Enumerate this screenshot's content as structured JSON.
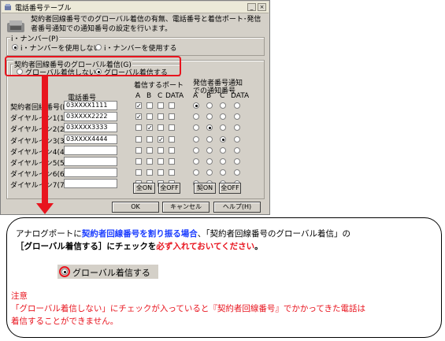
{
  "window": {
    "title": "電話番号テーブル",
    "minimize": "_",
    "close": "×"
  },
  "description": "契約者回線番号でのグローバル着信の有無、電話番号と着信ポート･発信者番号通知での通知番号の設定を行います。",
  "inumber_group": {
    "label": "i・ナンバー(P)",
    "options": [
      {
        "label": "i・ナンバーを使用しない",
        "selected": true
      },
      {
        "label": "i・ナンバーを使用する",
        "selected": false
      }
    ]
  },
  "global_group": {
    "label": "契約者回線番号のグローバル着信(G)",
    "options": [
      {
        "label": "グローバル着信しない",
        "selected": false
      },
      {
        "label": "グローバル着信する",
        "selected": true
      }
    ]
  },
  "table": {
    "col_phone": "電話番号",
    "col_ports": "着信するポート",
    "col_caller": "発信者番号通知での通知番号",
    "sub_headers": [
      "A",
      "B",
      "C",
      "DATA"
    ],
    "rows": [
      {
        "label": "契約者回線番号(I)",
        "phone": "03XXXX1111",
        "ports": [
          true,
          false,
          false,
          false
        ],
        "caller": 0
      },
      {
        "label": "ダイヤルイン1(1)",
        "phone": "03XXXX2222",
        "ports": [
          true,
          false,
          false,
          false
        ],
        "caller": -1
      },
      {
        "label": "ダイヤルイン2(2)",
        "phone": "03XXXX3333",
        "ports": [
          false,
          true,
          false,
          false
        ],
        "caller": 1
      },
      {
        "label": "ダイヤルイン3(3)",
        "phone": "03XXXX4444",
        "ports": [
          false,
          false,
          true,
          false
        ],
        "caller": 2
      },
      {
        "label": "ダイヤルイン4(4)",
        "phone": "",
        "ports": [
          false,
          false,
          false,
          false
        ],
        "caller": -1
      },
      {
        "label": "ダイヤルイン5(5)",
        "phone": "",
        "ports": [
          false,
          false,
          false,
          false
        ],
        "caller": -1
      },
      {
        "label": "ダイヤルイン6(6)",
        "phone": "",
        "ports": [
          false,
          false,
          false,
          false
        ],
        "caller": -1
      },
      {
        "label": "ダイヤルイン7(7)",
        "phone": "",
        "ports": [
          false,
          false,
          false,
          false
        ],
        "caller": -1
      }
    ]
  },
  "buttons": {
    "all_on": "全ON",
    "all_off": "全OFF",
    "contract_on": "契ON",
    "all_off2": "全OFF",
    "ok": "OK",
    "cancel": "キャンセル",
    "help": "ヘルプ(H)"
  },
  "callout": {
    "line1_a": "アナログポートに",
    "line1_b": "契約者回線番号を割り振る場合",
    "line1_c": "、「契約者回線番号のグローバル着信」の",
    "line2_a": "［グローバル着信する］にチェックを",
    "line2_b": "必ず入れておいてください",
    "line2_c": "。",
    "sample_label": "グローバル着信する",
    "note_title": "注意",
    "note_line1": "「グローバル着信しない」にチェックが入っていると『契約者回線番号』でかかってきた電話は",
    "note_line2": "着信することができません。"
  },
  "colors": {
    "accent_red": "#e8141e",
    "accent_blue": "#1a3cff",
    "dialog_bg": "#d4d0c8"
  }
}
